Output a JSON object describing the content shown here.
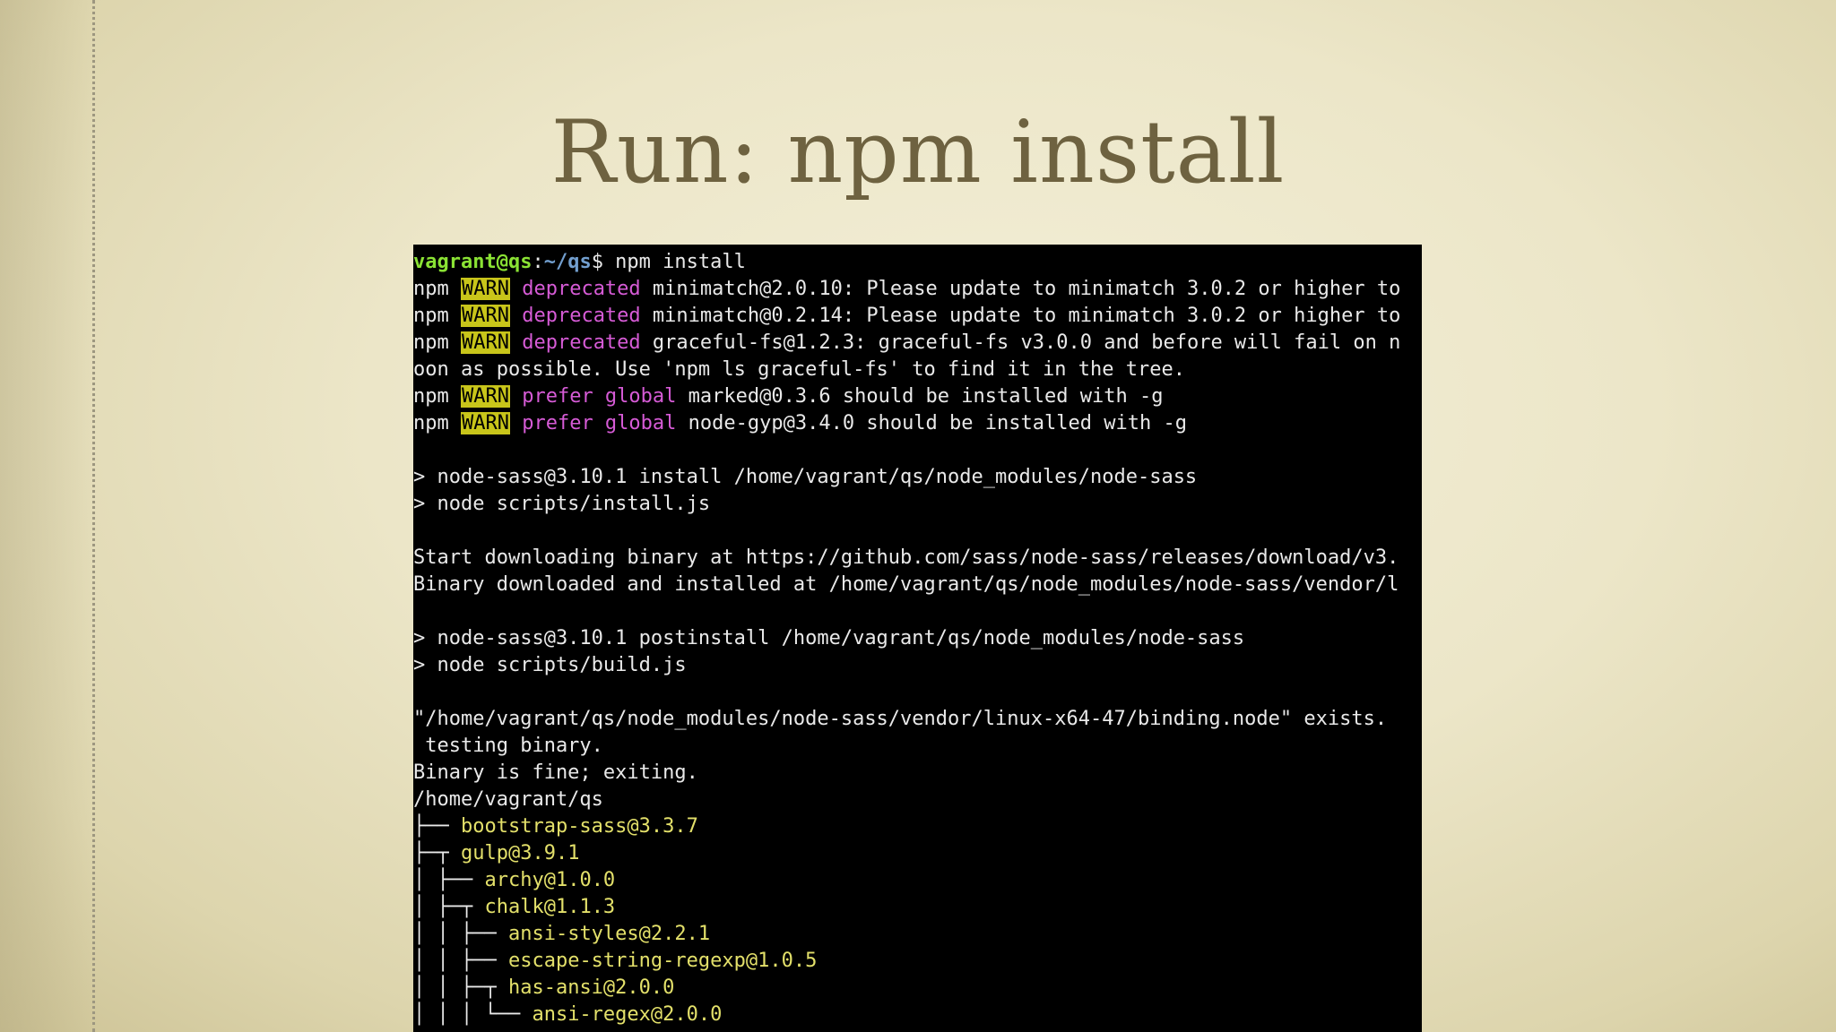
{
  "slide": {
    "title": "Run: npm install"
  },
  "terminal": {
    "prompt_user": "vagrant@qs",
    "prompt_colon": ":",
    "prompt_path": "~/qs",
    "prompt_symbol": "$",
    "command": " npm install",
    "npm": "npm ",
    "warn": "WARN",
    "warn_lines": [
      {
        "tag": "deprecated",
        "message": " minimatch@2.0.10: Please update to minimatch 3.0.2 or higher to"
      },
      {
        "tag": "deprecated",
        "message": " minimatch@0.2.14: Please update to minimatch 3.0.2 or higher to"
      },
      {
        "tag": "deprecated",
        "message": " graceful-fs@1.2.3: graceful-fs v3.0.0 and before will fail on n"
      }
    ],
    "wrap_line": "oon as possible. Use 'npm ls graceful-fs' to find it in the tree.",
    "prefer_lines": [
      {
        "tag": "prefer global",
        "message": " marked@0.3.6 should be installed with -g"
      },
      {
        "tag": "prefer global",
        "message": " node-gyp@3.4.0 should be installed with -g"
      }
    ],
    "output_lines": [
      "> node-sass@3.10.1 install /home/vagrant/qs/node_modules/node-sass",
      "> node scripts/install.js",
      "Start downloading binary at https://github.com/sass/node-sass/releases/download/v3.",
      "Binary downloaded and installed at /home/vagrant/qs/node_modules/node-sass/vendor/l",
      "> node-sass@3.10.1 postinstall /home/vagrant/qs/node_modules/node-sass",
      "> node scripts/build.js",
      "\"/home/vagrant/qs/node_modules/node-sass/vendor/linux-x64-47/binding.node\" exists.",
      " testing binary.",
      "Binary is fine; exiting.",
      "/home/vagrant/qs"
    ],
    "tree": [
      {
        "prefix": "├── ",
        "pkg": "bootstrap-sass@3.3.7"
      },
      {
        "prefix": "├─┬ ",
        "pkg": "gulp@3.9.1"
      },
      {
        "prefix": "│ ├── ",
        "pkg": "archy@1.0.0"
      },
      {
        "prefix": "│ ├─┬ ",
        "pkg": "chalk@1.1.3"
      },
      {
        "prefix": "│ │ ├── ",
        "pkg": "ansi-styles@2.2.1"
      },
      {
        "prefix": "│ │ ├── ",
        "pkg": "escape-string-regexp@1.0.5"
      },
      {
        "prefix": "│ │ ├─┬ ",
        "pkg": "has-ansi@2.0.0"
      },
      {
        "prefix": "│ │ │ └── ",
        "pkg": "ansi-regex@2.0.0"
      }
    ],
    "colors": {
      "prompt_user": "#8ae234",
      "prompt_path": "#729fcf",
      "warn_bg": "#c8c51a",
      "tag": "#d65bd6",
      "package": "#e3e06a"
    }
  }
}
